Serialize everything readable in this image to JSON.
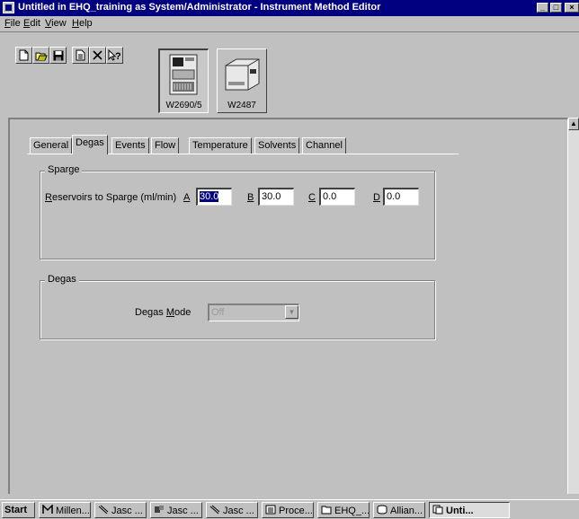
{
  "window": {
    "title": "Untitled in EHQ_training as System/Administrator - Instrument Method Editor",
    "title_bg": "#000080"
  },
  "menu": [
    "File",
    "Edit",
    "View",
    "Help"
  ],
  "toolbar": {
    "buttons": [
      "new-icon",
      "open-icon",
      "save-icon",
      "report-icon",
      "delete-icon",
      "context-help-icon"
    ],
    "instruments": [
      "W2690/5",
      "W2487"
    ]
  },
  "tabs": [
    "General",
    "Degas",
    "Events",
    "Flow",
    "Temperature",
    "Solvents",
    "Channel"
  ],
  "active_tab": "Degas",
  "sparge": {
    "group_title": "Sparge",
    "label": "Reservoirs to Sparge (ml/min)",
    "reservoirs": [
      {
        "letter": "A",
        "value": "30.0",
        "selected": true
      },
      {
        "letter": "B",
        "value": "30.0"
      },
      {
        "letter": "C",
        "value": "0.0"
      },
      {
        "letter": "D",
        "value": "0.0"
      }
    ]
  },
  "degas": {
    "group_title": "Degas",
    "mode_label": "Degas Mode",
    "mode_value": "Off",
    "mode_enabled": false
  },
  "taskbar": {
    "start": "Start",
    "items": [
      "Millen...",
      "Jasc ...",
      "Jasc ...",
      "Jasc ...",
      "Proce...",
      "EHQ_...",
      "Allian...",
      "Unti..."
    ],
    "active": "Unti..."
  }
}
